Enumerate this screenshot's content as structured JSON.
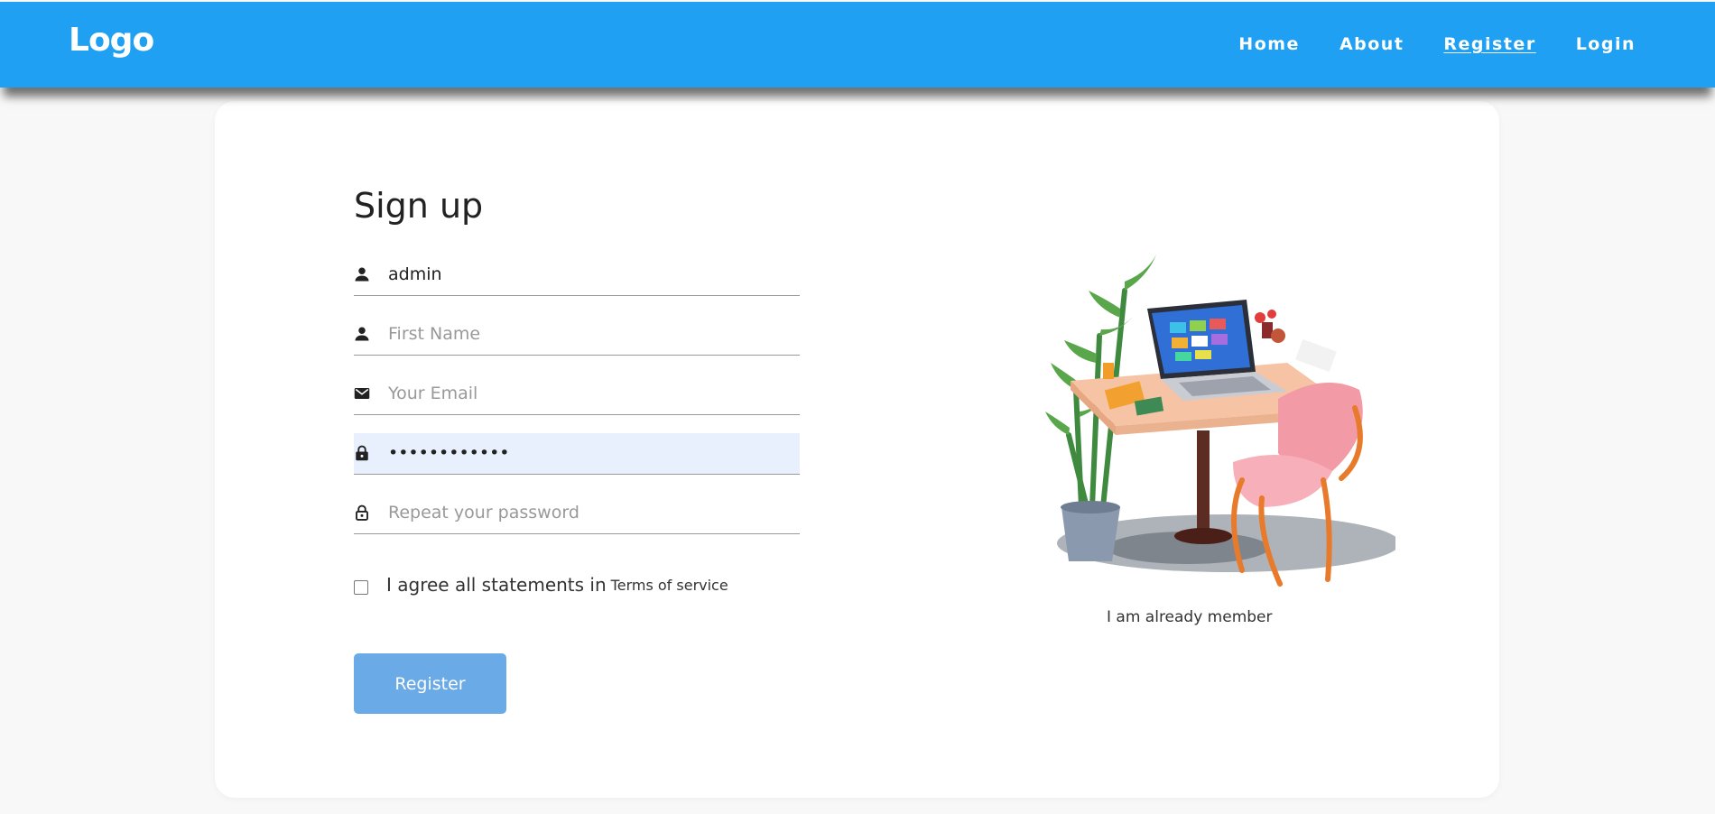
{
  "header": {
    "logo": "Logo",
    "nav": [
      "Home",
      "About",
      "Register",
      "Login"
    ],
    "active_nav": "Register",
    "bg_color": "#1fa0f2"
  },
  "form": {
    "title": "Sign up",
    "fields": [
      {
        "icon": "person-icon",
        "value": "admin",
        "placeholder": ""
      },
      {
        "icon": "person-icon",
        "value": "",
        "placeholder": "First Name"
      },
      {
        "icon": "envelope-icon",
        "value": "",
        "placeholder": "Your Email"
      },
      {
        "icon": "lock-icon",
        "value": "••••••••••••",
        "placeholder": ""
      },
      {
        "icon": "lock-outline-icon",
        "value": "",
        "placeholder": "Repeat your password"
      }
    ],
    "terms_text": "I agree all statements in",
    "terms_link": "Terms of service",
    "terms_checked": false,
    "submit_label": "Register",
    "submit_color": "#6aaae6"
  },
  "side": {
    "illustration": "desk-laptop-chair-illustration",
    "member_link": "I am already member"
  }
}
